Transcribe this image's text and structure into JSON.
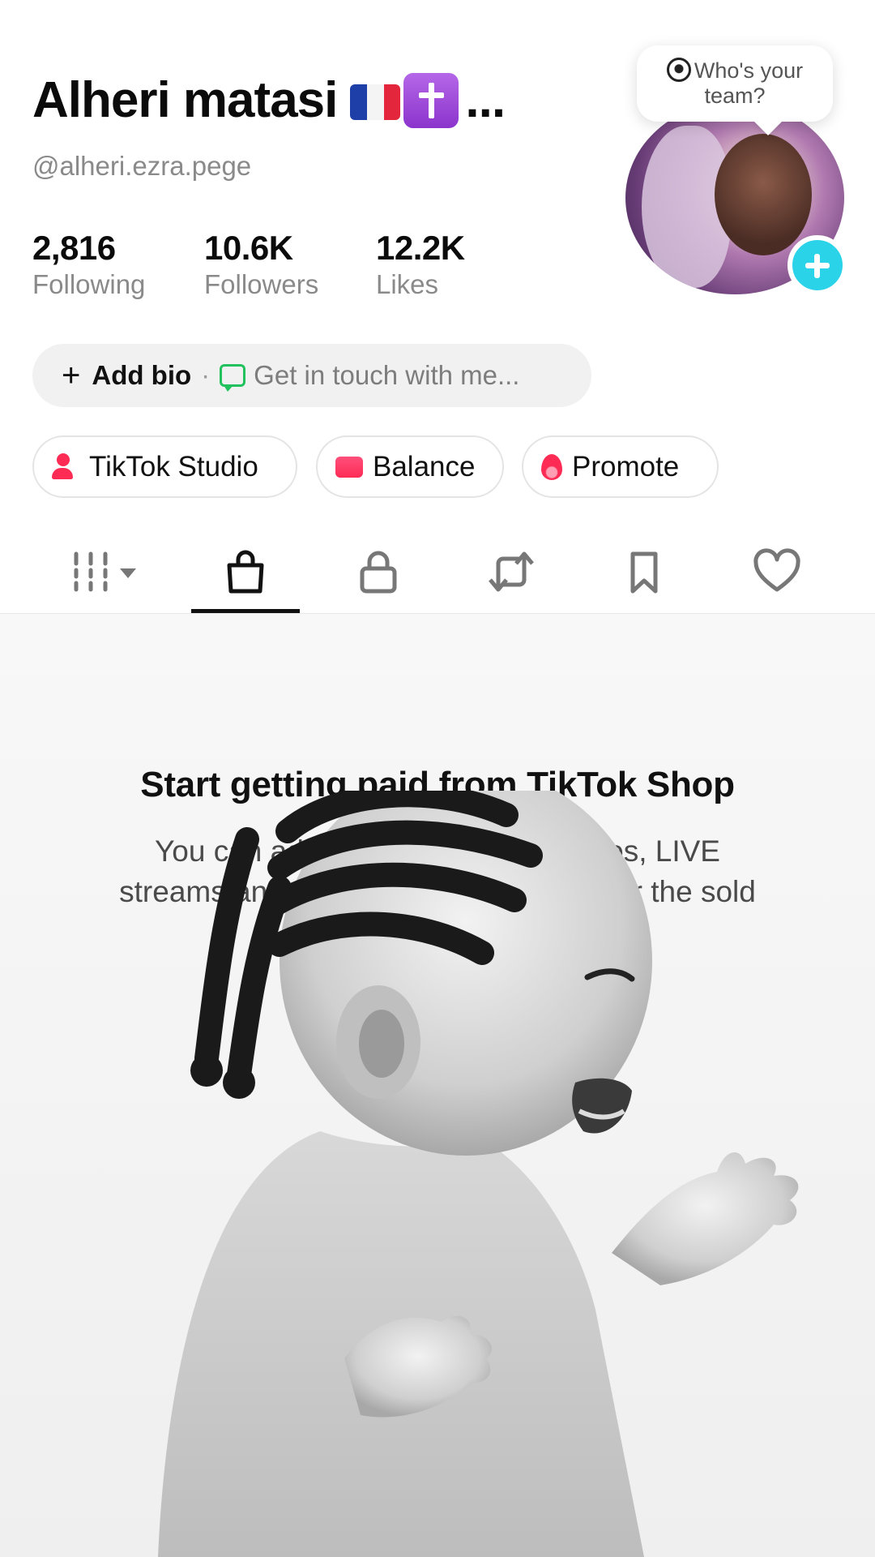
{
  "profile": {
    "display_name": "Alheri matasi",
    "name_ellipsis": "...",
    "username": "@alheri.ezra.pege",
    "tooltip_text": "Who's your team?"
  },
  "stats": [
    {
      "value": "2,816",
      "label": "Following"
    },
    {
      "value": "10.6K",
      "label": "Followers"
    },
    {
      "value": "12.2K",
      "label": "Likes"
    }
  ],
  "bio": {
    "add_label": "Add bio",
    "separator": "·",
    "contact_text": "Get in touch with me..."
  },
  "actions": [
    {
      "label": "TikTok Studio",
      "icon": "studio-icon"
    },
    {
      "label": "Balance",
      "icon": "wallet-icon"
    },
    {
      "label": "Promote",
      "icon": "fire-icon"
    }
  ],
  "tabs": [
    {
      "name": "videos-grid-icon",
      "selected": false
    },
    {
      "name": "shop-bag-icon",
      "selected": true
    },
    {
      "name": "lock-icon",
      "selected": false
    },
    {
      "name": "repost-icon",
      "selected": false
    },
    {
      "name": "bookmark-icon",
      "selected": false
    },
    {
      "name": "heart-icon",
      "selected": false
    }
  ],
  "shop": {
    "title": "Start getting paid from TikTok Shop",
    "description_line1": "You can add products to your videos, LIVE",
    "description_line2": "streams and showcase and get paid for the sold"
  },
  "colors": {
    "accent": "#fe2c55",
    "plus_button": "#2bd3e8",
    "chat_green": "#21c25e"
  }
}
